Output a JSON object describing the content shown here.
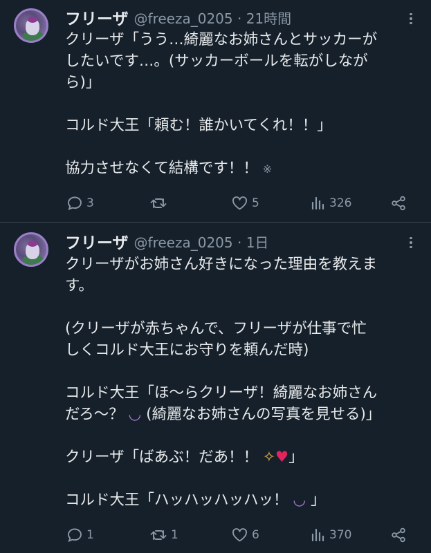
{
  "tweets": [
    {
      "author": "フリーザ",
      "handle_time": "@freeza_0205 · 21時間",
      "lines": [
        "クリーザ「うう…綺麗なお姉さんとサッカーが",
        "したいです…。(サッカーボールを転がしなが",
        "ら)」",
        "",
        "コルド大王「頼む！誰かいてくれ！！」",
        "",
        "協力させなくて結構です！！"
      ],
      "trailing_emoji": "※",
      "replies": "3",
      "retweets": "",
      "likes": "5",
      "views": "326"
    },
    {
      "author": "フリーザ",
      "handle_time": "@freeza_0205 · 1日",
      "lines": [
        "クリーザがお姉さん好きになった理由を教えま",
        "す。",
        "",
        "(クリーザが赤ちゃんで、フリーザが仕事で忙",
        "しくコルド大王にお守りを頼んだ時)",
        "",
        "コルド大王「ほ〜らクリーザ！綺麗なお姉さん",
        "だろ〜？ (綺麗なお姉さんの写真を見せる)」",
        "",
        "クリーザ「ばあぶ！だあ！！ 」",
        "",
        "コルド大王「ハッハッハッハッ！ 」"
      ],
      "replies": "1",
      "retweets": "1",
      "likes": "6",
      "views": "370"
    }
  ],
  "colors": {
    "background": "#15202b",
    "text": "#e7e9ea",
    "secondary": "#8b98a5",
    "divider": "#38444d"
  },
  "icons": [
    "avatar",
    "more-dots-icon",
    "reply-icon",
    "retweet-icon",
    "like-icon",
    "views-icon",
    "share-icon",
    "smile-emoji-icon",
    "sparkles-icon",
    "hearts-icon"
  ]
}
